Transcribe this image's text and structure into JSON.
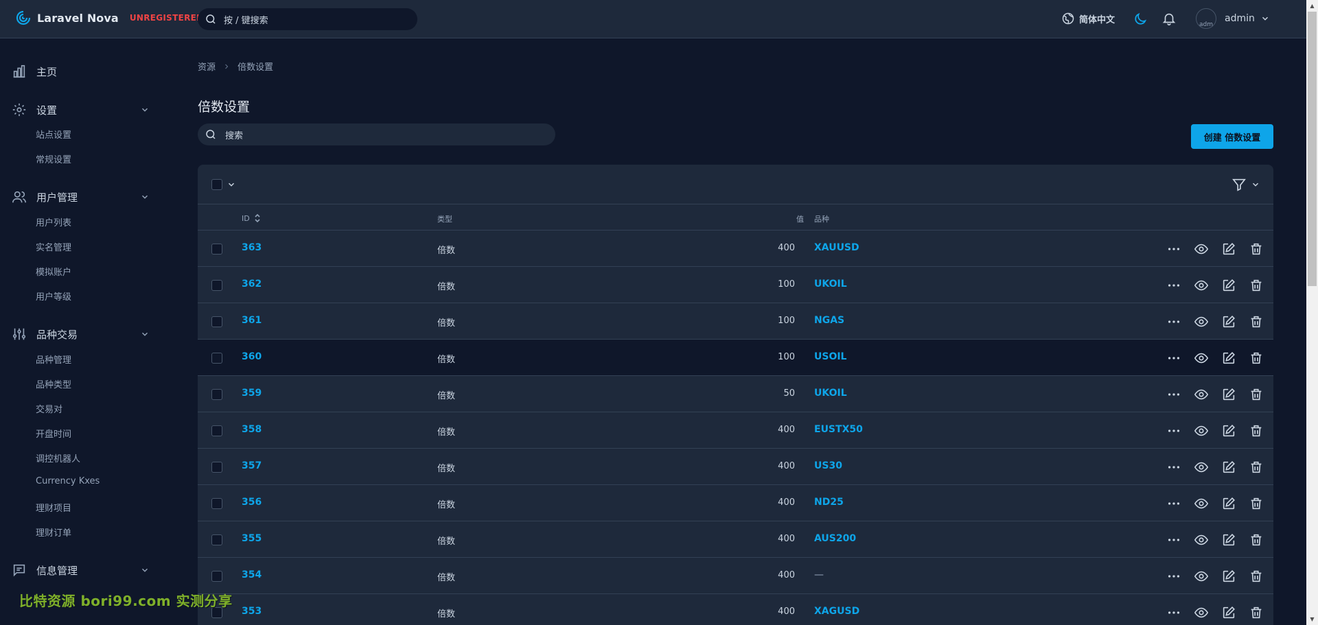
{
  "brand": {
    "name": "Laravel Nova",
    "tag": "UNREGISTERED"
  },
  "global_search": {
    "placeholder": "按 / 键搜索"
  },
  "header": {
    "language": "简体中文",
    "user_name": "admin",
    "avatar_alt": "adm"
  },
  "sidebar": {
    "home": "主页",
    "settings": {
      "label": "设置",
      "items": [
        "站点设置",
        "常规设置"
      ]
    },
    "users": {
      "label": "用户管理",
      "items": [
        "用户列表",
        "实名管理",
        "模拟账户",
        "用户等级"
      ]
    },
    "trading": {
      "label": "品种交易",
      "items": [
        "品种管理",
        "品种类型",
        "交易对",
        "开盘时间",
        "调控机器人",
        "Currency Kxes",
        "理财项目",
        "理财订单"
      ]
    },
    "messages": {
      "label": "信息管理"
    }
  },
  "breadcrumb": {
    "root": "资源",
    "current": "倍数设置"
  },
  "page_title": "倍数设置",
  "resource_search": {
    "placeholder": "搜索"
  },
  "create_button": "创建 倍数设置",
  "table": {
    "headers": {
      "id": "ID",
      "type": "类型",
      "value": "值",
      "variety": "品种"
    },
    "rows": [
      {
        "id": "363",
        "type": "倍数",
        "value": "400",
        "variety": "XAUUSD"
      },
      {
        "id": "362",
        "type": "倍数",
        "value": "100",
        "variety": "UKOIL"
      },
      {
        "id": "361",
        "type": "倍数",
        "value": "100",
        "variety": "NGAS"
      },
      {
        "id": "360",
        "type": "倍数",
        "value": "100",
        "variety": "USOIL"
      },
      {
        "id": "359",
        "type": "倍数",
        "value": "50",
        "variety": "UKOIL"
      },
      {
        "id": "358",
        "type": "倍数",
        "value": "400",
        "variety": "EUSTX50"
      },
      {
        "id": "357",
        "type": "倍数",
        "value": "400",
        "variety": "US30"
      },
      {
        "id": "356",
        "type": "倍数",
        "value": "400",
        "variety": "ND25"
      },
      {
        "id": "355",
        "type": "倍数",
        "value": "400",
        "variety": "AUS200"
      },
      {
        "id": "354",
        "type": "倍数",
        "value": "400",
        "variety": "—"
      },
      {
        "id": "353",
        "type": "倍数",
        "value": "400",
        "variety": "XAGUSD"
      }
    ]
  },
  "watermark": "比特资源 bori99.com 实测分享",
  "colors": {
    "accent": "#0ea5e9",
    "background": "#0f172a",
    "panel": "#1e293b",
    "unregistered": "#ef4444"
  }
}
